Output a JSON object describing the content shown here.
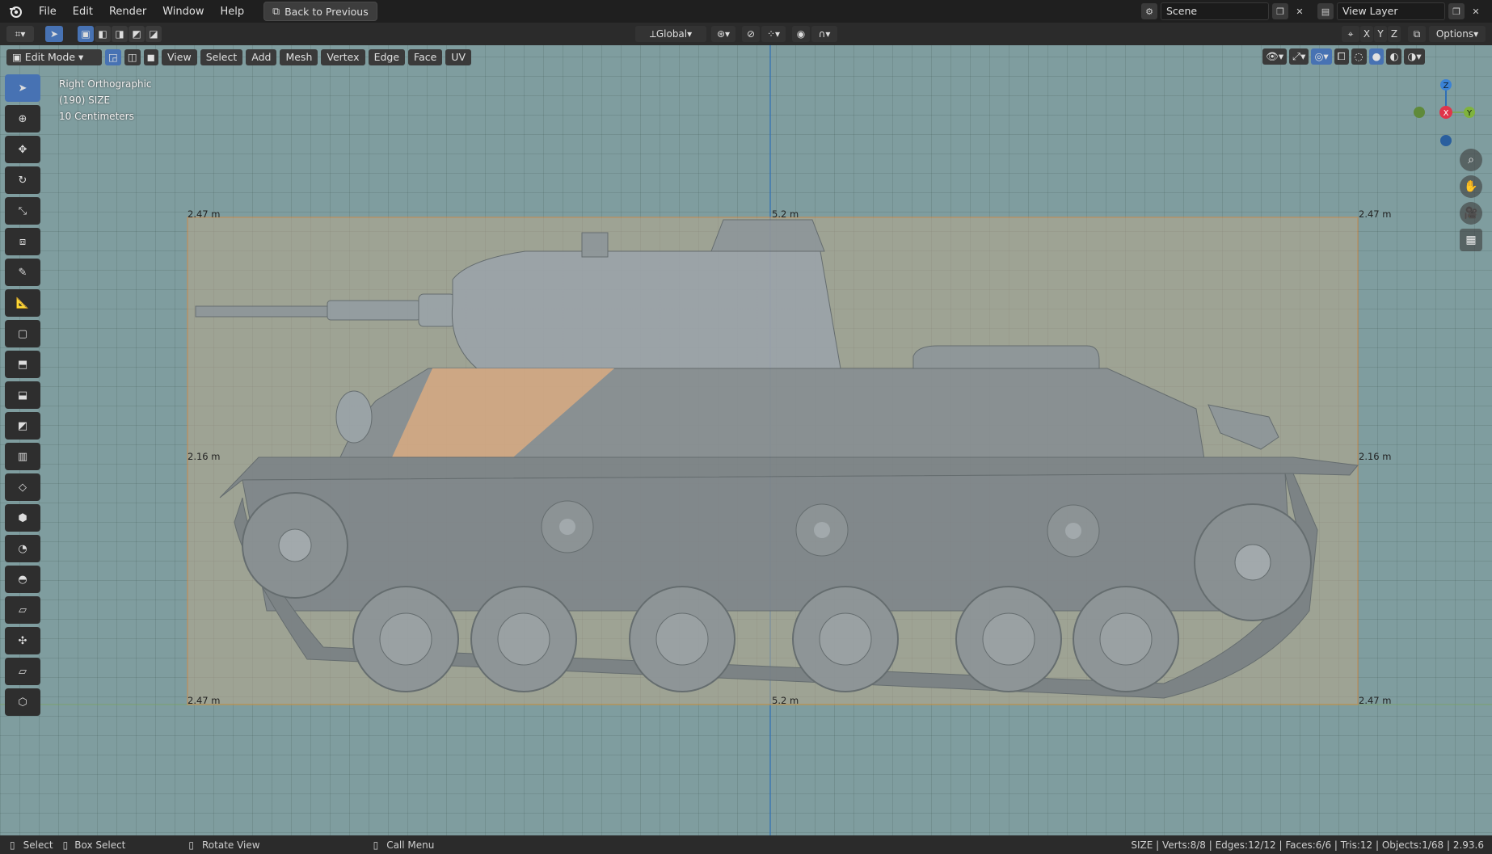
{
  "menu": {
    "items": [
      "File",
      "Edit",
      "Render",
      "Window",
      "Help"
    ],
    "back_label": "Back to Previous"
  },
  "topright": {
    "scene_label": "Scene",
    "view_layer_label": "View Layer"
  },
  "toolbar": {
    "orientation": "Global",
    "axis_x": "X",
    "axis_y": "Y",
    "axis_z": "Z",
    "options": "Options"
  },
  "header": {
    "mode": "Edit Mode",
    "menus": [
      "View",
      "Select",
      "Add",
      "Mesh",
      "Vertex",
      "Edge",
      "Face",
      "UV"
    ]
  },
  "overlay": {
    "view_name": "Right Orthographic",
    "object_line": "(190) SIZE",
    "scale_line": "10 Centimeters"
  },
  "dimensions": {
    "top_left": "2.47 m",
    "top_center": "5.2 m",
    "top_right": "2.47 m",
    "mid_left": "2.16 m",
    "mid_right": "2.16 m",
    "bottom_left": "2.47 m",
    "bottom_center": "5.2 m",
    "bottom_right": "2.47 m"
  },
  "gizmo": {
    "z": "Z",
    "x": "X",
    "y": "Y"
  },
  "status": {
    "select": "Select",
    "box_select": "Box Select",
    "rotate": "Rotate View",
    "call_menu": "Call Menu",
    "stats": "SIZE | Verts:8/8 | Edges:12/12 | Faces:6/6 | Tris:12 | Objects:1/68 | 2.93.6"
  },
  "colors": {
    "accent": "#4772b3",
    "viewport_bg": "#7f9d9f",
    "selection_outline": "#e08a3c"
  }
}
